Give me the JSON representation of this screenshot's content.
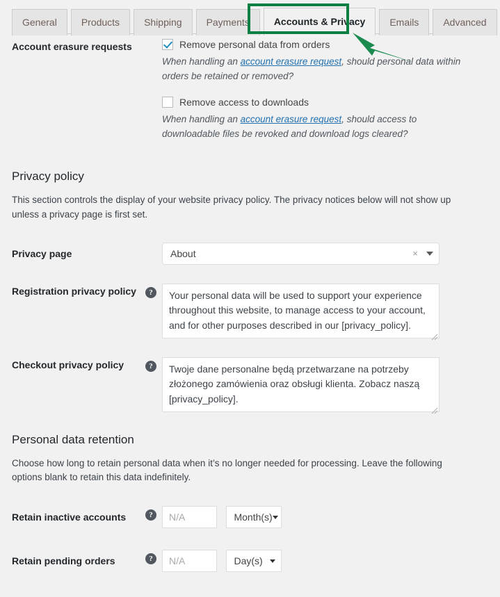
{
  "tabs": [
    {
      "label": "General",
      "active": false
    },
    {
      "label": "Products",
      "active": false
    },
    {
      "label": "Shipping",
      "active": false
    },
    {
      "label": "Payments",
      "active": false
    },
    {
      "label": "Accounts & Privacy",
      "active": true
    },
    {
      "label": "Emails",
      "active": false
    },
    {
      "label": "Advanced",
      "active": false
    }
  ],
  "annotation": {
    "highlight_color": "#0c8043",
    "arrow_color": "#1a8a4f",
    "target_tab": "Accounts & Privacy"
  },
  "erasure": {
    "label": "Account erasure requests",
    "option1": {
      "text": "Remove personal data from orders",
      "checked": true,
      "desc_before": "When handling an ",
      "desc_link": "account erasure request",
      "desc_after": ", should personal data within orders be retained or removed?"
    },
    "option2": {
      "text": "Remove access to downloads",
      "checked": false,
      "desc_before": "When handling an ",
      "desc_link": "account erasure request",
      "desc_after": ", should access to downloadable files be revoked and download logs cleared?"
    }
  },
  "privacy_policy": {
    "title": "Privacy policy",
    "description": "This section controls the display of your website privacy policy. The privacy notices below will not show up unless a privacy page is first set.",
    "privacy_page": {
      "label": "Privacy page",
      "value": "About",
      "clear_symbol": "×"
    },
    "registration": {
      "label": "Registration privacy policy",
      "help": "?",
      "value": "Your personal data will be used to support your experience throughout this website, to manage access to your account, and for other purposes described in our [privacy_policy]."
    },
    "checkout": {
      "label": "Checkout privacy policy",
      "help": "?",
      "value": "Twoje dane personalne będą przetwarzane na potrzeby złożonego zamówienia oraz obsługi klienta. Zobacz naszą [privacy_policy]."
    }
  },
  "retention": {
    "title": "Personal data retention",
    "description": "Choose how long to retain personal data when it’s no longer needed for processing. Leave the following options blank to retain this data indefinitely.",
    "rows": [
      {
        "label": "Retain inactive accounts",
        "help": "?",
        "placeholder": "N/A",
        "value": "",
        "unit": "Month(s)"
      },
      {
        "label": "Retain pending orders",
        "help": "?",
        "placeholder": "N/A",
        "value": "",
        "unit": "Day(s)"
      }
    ]
  }
}
